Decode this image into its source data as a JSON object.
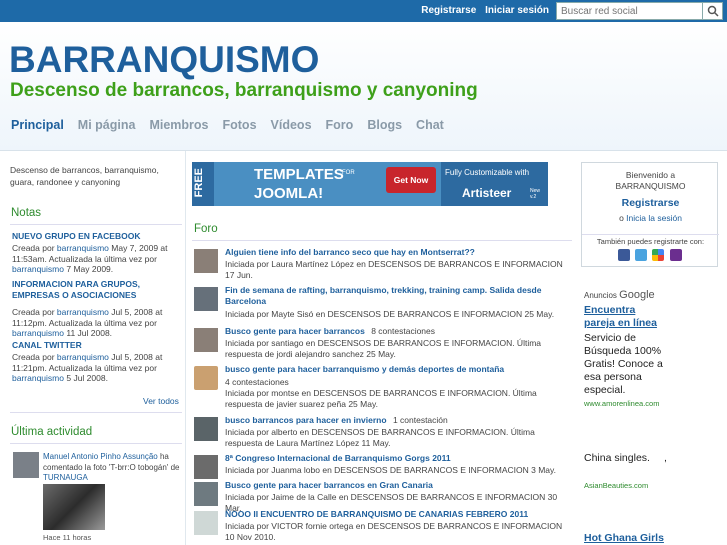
{
  "topbar": {
    "register": "Registrarse",
    "login": "Iniciar sesión",
    "search_placeholder": "Buscar red social"
  },
  "site": {
    "title": "BARRANQUISMO",
    "subtitle": "Descenso de barrancos, barranquismo y canyoning"
  },
  "nav": [
    "Principal",
    "Mi página",
    "Miembros",
    "Fotos",
    "Vídeos",
    "Foro",
    "Blogs",
    "Chat"
  ],
  "left": {
    "description": "Descenso de barrancos, barranquismo, guara, randonee y canyoning",
    "notes_head": "Notas",
    "notes": [
      {
        "title": "NUEVO GRUPO EN FACEBOOK",
        "l1": "Creada por",
        "a1": "barranquismo",
        "d1": "May 7, 2009 at",
        "l2": "11:53am. Actualizada la última vez por",
        "a2": "barranquismo",
        "d2": "7 May 2009."
      },
      {
        "title": "INFORMACION PARA GRUPOS, EMPRESAS O ASOCIACIONES",
        "l1": "Creada por",
        "a1": "barranquismo",
        "d1": "Jul 5, 2008 at",
        "l2": "11:12pm. Actualizada la última vez por",
        "a2": "barranquismo",
        "d2": "11 Jul 2008."
      },
      {
        "title": "CANAL TWITTER",
        "l1": "Creada por",
        "a1": "barranquismo",
        "d1": "Jul 5, 2008 at",
        "l2": "11:21pm. Actualizada la última vez por",
        "a2": "barranquismo",
        "d2": "5 Jul 2008."
      }
    ],
    "see_all": "Ver todos",
    "activity_head": "Última actividad",
    "activity": {
      "name": "Manuel Antonio Pinho Assunção",
      "text": "ha comentado la foto 'T-brr:O tobogán' de",
      "target": "TURNAUGA",
      "time": "Hace 11 horas"
    }
  },
  "forum": {
    "head": "Foro",
    "topics": [
      {
        "title": "Alguien tiene info del barranco seco que hay en Montserrat??",
        "meta": "Iniciada por Laura Martínez López en DESCENSOS DE BARRANCOS E INFORMACION 17 Jun."
      },
      {
        "title": "Fin de semana de rafting, barranquismo, trekking, training camp. Salida desde Barcelona",
        "meta": "Iniciada por Mayte Sisó en DESCENSOS DE BARRANCOS E INFORMACION 25 May."
      },
      {
        "title": "Busco gente para hacer barrancos",
        "count": "8 contestaciones",
        "meta": "Iniciada por santiago en DESCENSOS DE BARRANCOS E INFORMACION. Última respuesta de jordi alejandro sanchez 25 May."
      },
      {
        "title": "busco gente para hacer barranquismo y demás deportes de montaña",
        "count": "4 contestaciones",
        "meta": "Iniciada por montse en DESCENSOS DE BARRANCOS E INFORMACION. Última respuesta de javier suarez peña 25 May."
      },
      {
        "title": "busco barrancos para hacer en invierno",
        "count": "1 contestación",
        "meta": "Iniciada por alberto en DESCENSOS DE BARRANCOS E INFORMACION. Última respuesta de Laura Martínez López 11 May."
      },
      {
        "title": "8ª Congreso Internacional de Barranquismo Gorgs 2011",
        "meta": "Iniciada por Juanma lobo en DESCENSOS DE BARRANCOS E INFORMACION 3 May."
      },
      {
        "title": "Busco gente para hacer barrancos en Gran Canaria",
        "meta": "Iniciada por Jaime de la Calle en DESCENSOS DE BARRANCOS E INFORMACION 30 Mar."
      },
      {
        "title": "ÑOOO II ENCUENTRO DE BARRANQUISMO DE CANARIAS FEBRERO 2011",
        "meta": "Iniciada por VICTOR fornie ortega en DESCENSOS DE BARRANCOS E INFORMACION 10 Nov 2010."
      }
    ]
  },
  "banner": {
    "free": "FREE",
    "line1": "TEMPLATES",
    "for": "FOR",
    "line2": "JOOMLA!",
    "getnow": "Get Now",
    "fully": "Fully Customizable with",
    "brand": "Artisteer",
    "new": "New v.2"
  },
  "signin": {
    "welcome": "Bienvenido a",
    "site": "BARRANQUISMO",
    "register": "Registrarse",
    "or": "o",
    "login": "Inicia la sesión",
    "also": "También puedes registrarte con:"
  },
  "ads": {
    "label": "Anuncios",
    "google": "Google",
    "items": [
      {
        "title": "Encuentra pareja en línea",
        "text": "Servicio de Búsqueda 100% Gratis! Conoce a esa persona especial.",
        "url": "www.amorenlinea.com"
      },
      {
        "title": "China singles.",
        "url": "AsianBeauties.com"
      },
      {
        "title": "Hot Ghana Girls"
      }
    ]
  },
  "colors": {
    "accent": "#1e5f9c",
    "green": "#3ea01a",
    "topbar": "#1e6aa8"
  }
}
